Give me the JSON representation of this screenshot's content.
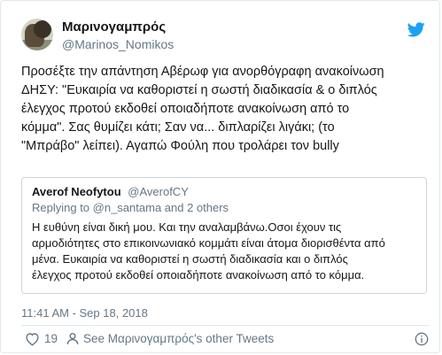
{
  "author": {
    "name": "Μαρινογαμπρός",
    "handle": "@Marinos_Nomikos"
  },
  "tweet": {
    "text": "Προσέξτε την απάντηση Αβέρωφ για ανορθόγραφη ανακοίνωση\nΔΗΣΥ: \"Ευκαιρία να καθοριστεί η σωστή διαδικασία & ο διπλός\nέλεγχος προτού εκδοθεί οποιαδήποτε ανακοίνωση από το\nκόμμα\". Σας θυμίζει κάτι; Σαν να... διπλαρίζει λιγάκι; (το\n\"Μπράβο\" λείπει). Αγαπώ Φούλη που τρολάρει τον bully"
  },
  "quoted": {
    "name": "Averof Neofytou",
    "handle": "@AverofCY",
    "reply_to": "Replying to @n_santama and 2 others",
    "text": "Η ευθύνη είναι δική μου. Και την αναλαμβάνω.Οσοι έχουν τις\nαρμοδιότητες  στο επικοινωνιακό κομμάτι είναι άτομα διορισθέντα από\nμένα. Ευκαιρία να καθοριστεί η σωστή διαδικασία και ο διπλός\nέλεγχος προτού εκδοθεί οποιαδήποτε ανακοίνωση από το κόμμα."
  },
  "meta": {
    "timestamp": "11:41 AM - Sep 18, 2018",
    "likes": "19",
    "other_tweets": "See Μαρινογαμπρός's other Tweets"
  },
  "icons": {
    "brand": "twitter-bird-icon",
    "like": "heart-icon",
    "profile": "person-icon",
    "info": "info-icon"
  },
  "colors": {
    "brand": "#1da1f2",
    "text": "#14171a",
    "secondary": "#657786",
    "border": "#e1e8ed"
  }
}
